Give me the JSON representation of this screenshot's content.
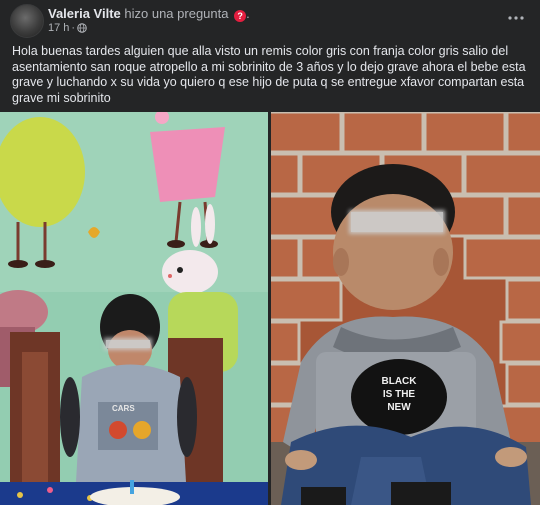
{
  "post": {
    "author": "Valeria Vilte",
    "action": "hizo una pregunta",
    "question_icon": "question-icon",
    "after_icon_dot": ".",
    "time": "17 h",
    "meta_sep": "·",
    "privacy_icon": "globe-icon",
    "more_icon": "more-horizontal-icon",
    "text": "Hola buenas tardes alguien que alla visto un remis color gris  con franja color gris salio del asentamiento san roque atropello a mi sobrinito de 3 años y lo dejo grave ahora el bebe esta grave y luchando x su vida yo quiero q ese hijo de puta q se entregue xfavor compartan esta grave mi sobrinito"
  },
  "photos": [
    {
      "name": "photo-child-birthday",
      "shirt_text": "CARS"
    },
    {
      "name": "photo-child-hoodie",
      "shirt_text": "BLACK IS THE NEW BLACK"
    }
  ],
  "colors": {
    "background": "#242526",
    "text_primary": "#e4e6eb",
    "text_secondary": "#b0b3b8",
    "question_icon": "#e41e3f"
  }
}
